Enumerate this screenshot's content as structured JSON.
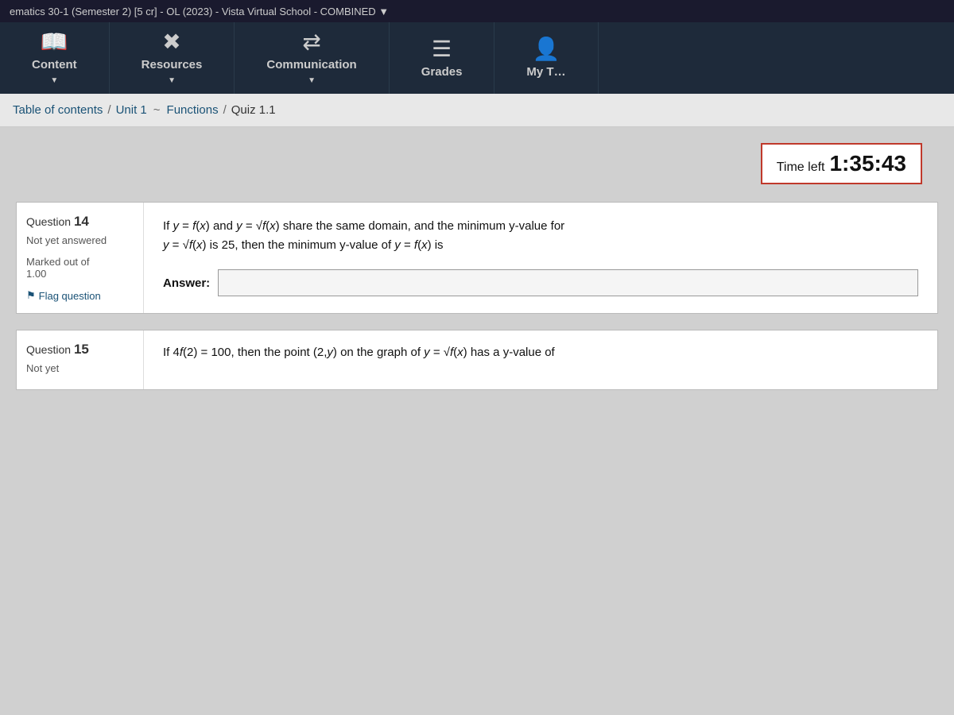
{
  "topbar": {
    "title": "ematics 30-1 (Semester 2) [5 cr] - OL (2023) - Vista Virtual School - COMBINED ▼"
  },
  "nav": {
    "items": [
      {
        "id": "content",
        "label": "Content",
        "icon": "📖",
        "arrow": "▼"
      },
      {
        "id": "resources",
        "label": "Resources",
        "icon": "✖",
        "arrow": "▼"
      },
      {
        "id": "communication",
        "label": "Communication",
        "icon": "⇄",
        "arrow": "▼"
      },
      {
        "id": "grades",
        "label": "Grades",
        "icon": "☰",
        "arrow": ""
      },
      {
        "id": "my-tools",
        "label": "My T…",
        "icon": "👤",
        "arrow": ""
      }
    ]
  },
  "breadcrumb": {
    "table_of_contents": "Table of contents",
    "sep1": "/",
    "unit": "Unit 1",
    "tilde": "~",
    "functions": "Functions",
    "sep2": "/",
    "current": "Quiz 1.1"
  },
  "timer": {
    "label": "Time left",
    "value": "1:35:43"
  },
  "questions": [
    {
      "number": "14",
      "status": "Not yet answered",
      "marked_out_of": "Marked out of",
      "score": "1.00",
      "flag_label": "Flag question",
      "question_text_line1": "If y = f(x) and y = √f(x) share the same domain, and the minimum y-value for",
      "question_text_line2": "y = √f(x) is 25, then the minimum y-value of y = f(x) is",
      "answer_label": "Answer:",
      "answer_value": ""
    },
    {
      "number": "15",
      "status": "Not yet",
      "question_text": "If 4f(2) = 100, then the point (2,y) on the graph of y = √f(x) has a y-value of"
    }
  ]
}
